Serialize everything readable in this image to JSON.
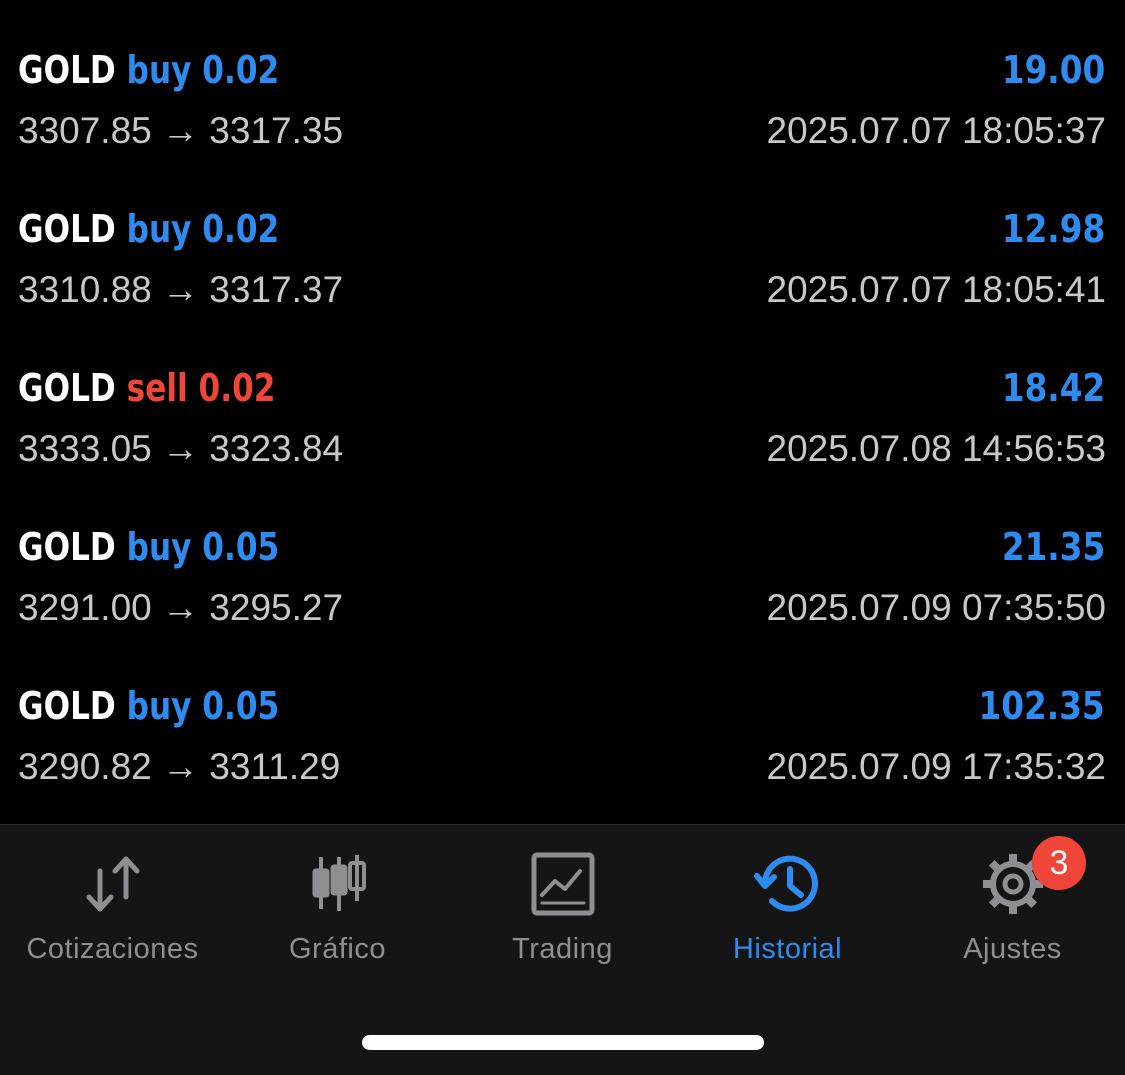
{
  "trades": [
    {
      "symbol": "GOLD",
      "side": "buy",
      "volume": "0.02",
      "profit": "19.00",
      "prices": "3307.85 → 3317.35",
      "time": "2025.07.07 18:05:37"
    },
    {
      "symbol": "GOLD",
      "side": "buy",
      "volume": "0.02",
      "profit": "12.98",
      "prices": "3310.88 → 3317.37",
      "time": "2025.07.07 18:05:41"
    },
    {
      "symbol": "GOLD",
      "side": "sell",
      "volume": "0.02",
      "profit": "18.42",
      "prices": "3333.05 → 3323.84",
      "time": "2025.07.08 14:56:53"
    },
    {
      "symbol": "GOLD",
      "side": "buy",
      "volume": "0.05",
      "profit": "21.35",
      "prices": "3291.00 → 3295.27",
      "time": "2025.07.09 07:35:50"
    },
    {
      "symbol": "GOLD",
      "side": "buy",
      "volume": "0.05",
      "profit": "102.35",
      "prices": "3290.82 → 3311.29",
      "time": "2025.07.09 17:35:32"
    }
  ],
  "tabs": [
    {
      "label": "Cotizaciones",
      "icon": "quotes-arrows-icon"
    },
    {
      "label": "Gráfico",
      "icon": "candlestick-chart-icon"
    },
    {
      "label": "Trading",
      "icon": "trading-chart-icon"
    },
    {
      "label": "Historial",
      "icon": "history-clock-icon",
      "active": true
    },
    {
      "label": "Ajustes",
      "icon": "gear-icon",
      "badge": "3"
    }
  ],
  "colors": {
    "accent": "#2e8cf0",
    "sell": "#f0463a",
    "inactive": "#8e8e93",
    "badge": "#f0463a"
  }
}
